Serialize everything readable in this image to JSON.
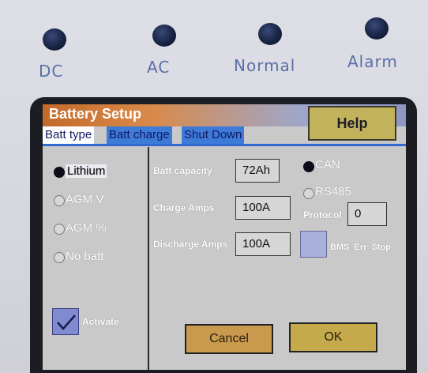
{
  "indicators": [
    {
      "label": "DC"
    },
    {
      "label": "AC"
    },
    {
      "label": "Normal"
    },
    {
      "label": "Alarm"
    }
  ],
  "screen": {
    "title": "Battery Setup",
    "help_label": "Help",
    "tabs": [
      {
        "label": "Batt type",
        "active": true
      },
      {
        "label": "Batt charge",
        "active": false
      },
      {
        "label": "Shut Down",
        "active": false
      }
    ],
    "battery_types": [
      {
        "label": "Lithium",
        "selected": true
      },
      {
        "label": "AGM V",
        "selected": false
      },
      {
        "label": "AGM %",
        "selected": false
      },
      {
        "label": "No batt",
        "selected": false
      }
    ],
    "activate": {
      "label": "Activate",
      "checked": true
    },
    "fields": {
      "capacity": {
        "label": "Batt capacity",
        "value": "72Ah"
      },
      "charge": {
        "label": "Charge Amps",
        "value": "100A"
      },
      "discharge": {
        "label": "Discharge Amps",
        "value": "100A"
      }
    },
    "comm": [
      {
        "label": "CAN",
        "selected": true
      },
      {
        "label": "RS485",
        "selected": false
      }
    ],
    "protocol": {
      "label": "Protocol",
      "value": "0"
    },
    "bms_err_stop": {
      "label": "BMS_Err_Stop",
      "checked": false
    },
    "cancel_label": "Cancel",
    "ok_label": "OK"
  },
  "colors": {
    "led": "#182344",
    "led_label": "#5a6fa8",
    "title_bar_left": "#c46a2a",
    "tab_active": "#ffffff",
    "tab_inactive": "#3e7ad8",
    "help_button": "#c2b25c",
    "cancel_button": "#c99a4e",
    "ok_button": "#c4aa4a"
  }
}
